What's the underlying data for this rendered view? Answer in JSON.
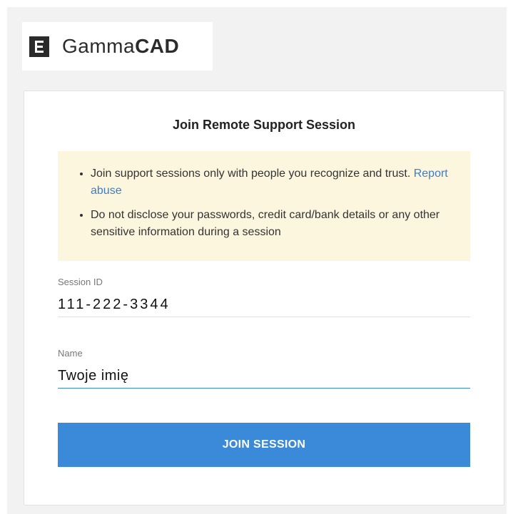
{
  "brand": {
    "logo_icon": "gammacad-logo-icon",
    "name_light": "Gamma",
    "name_bold": "CAD"
  },
  "card": {
    "title": "Join Remote Support Session"
  },
  "notice": {
    "item1_text": "Join support sessions only with people you recognize and trust.",
    "item1_link": "Report abuse",
    "item2_text": "Do not disclose your passwords, credit card/bank details or any other sensitive information during a session"
  },
  "form": {
    "session_id": {
      "label": "Session ID",
      "value": "111-222-3344"
    },
    "name": {
      "label": "Name",
      "value": "Twoje imię"
    },
    "submit_label": "JOIN SESSION"
  },
  "colors": {
    "accent": "#3b8ad9",
    "link": "#3a7fcf",
    "notice_bg": "#fcf6df"
  }
}
